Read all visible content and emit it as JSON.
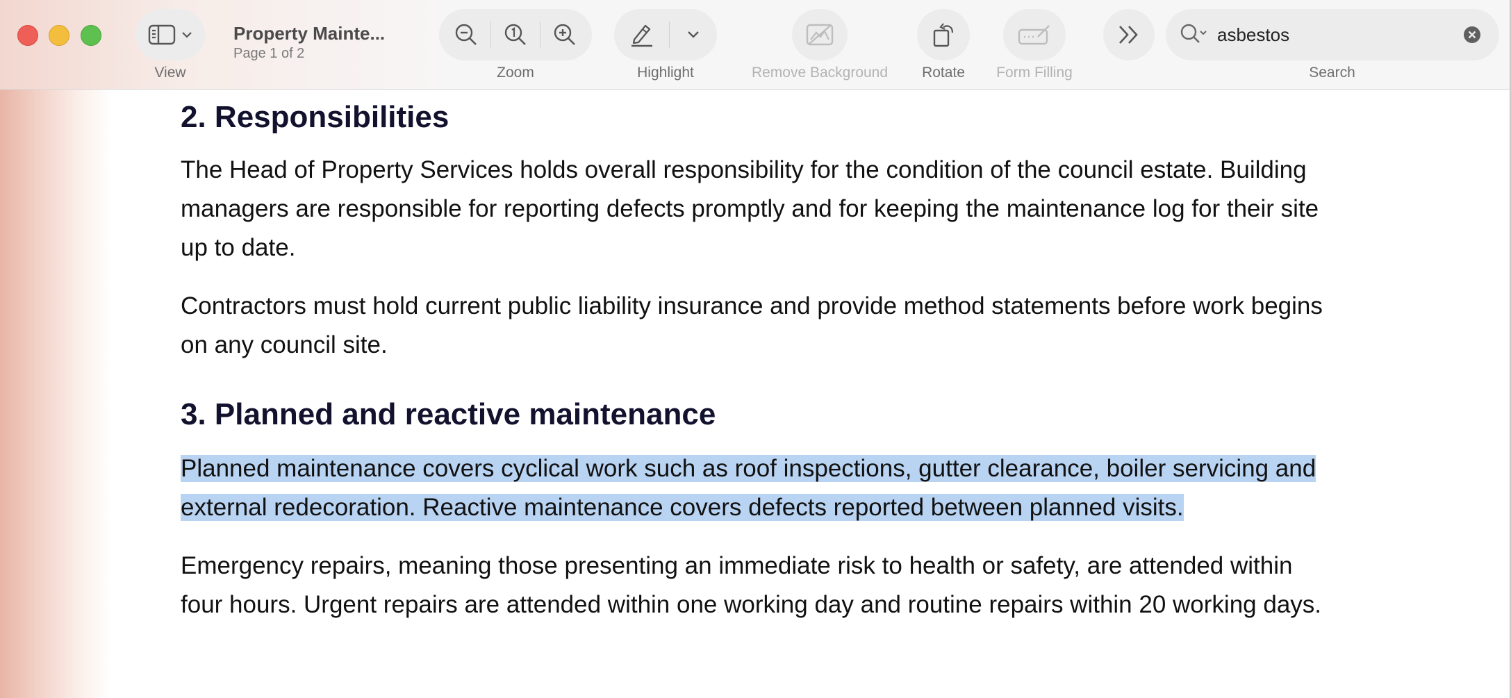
{
  "window": {
    "title": "Property Mainte...",
    "subtitle": "Page 1 of 2"
  },
  "toolbar": {
    "view_label": "View",
    "zoom_label": "Zoom",
    "highlight_label": "Highlight",
    "remove_background_label": "Remove Background",
    "rotate_label": "Rotate",
    "form_filling_label": "Form Filling",
    "search_label": "Search"
  },
  "search": {
    "value": "asbestos"
  },
  "document": {
    "section2": {
      "heading": "2. Responsibilities",
      "p1": "The Head of Property Services holds overall responsibility for the condition of the council estate. Building managers are responsible for reporting defects promptly and for keeping the maintenance log for their site up to date.",
      "p2": "Contractors must hold current public liability insurance and provide method statements before work begins on any council site."
    },
    "section3": {
      "heading": "3. Planned and reactive maintenance",
      "p1": "Planned maintenance covers cyclical work such as roof inspections, gutter clearance, boiler servicing and external redecoration. Reactive maintenance covers defects reported between planned visits.",
      "p2": "Emergency repairs, meaning those presenting an immediate risk to health or safety, are attended within four hours. Urgent repairs are attended within one working day and routine repairs within 20 working days."
    }
  },
  "colors": {
    "selection": "#b9d3f2",
    "heading": "#12122e",
    "close": "#ee5f57",
    "minimize": "#f3bd3e",
    "zoom": "#5ec04f"
  }
}
